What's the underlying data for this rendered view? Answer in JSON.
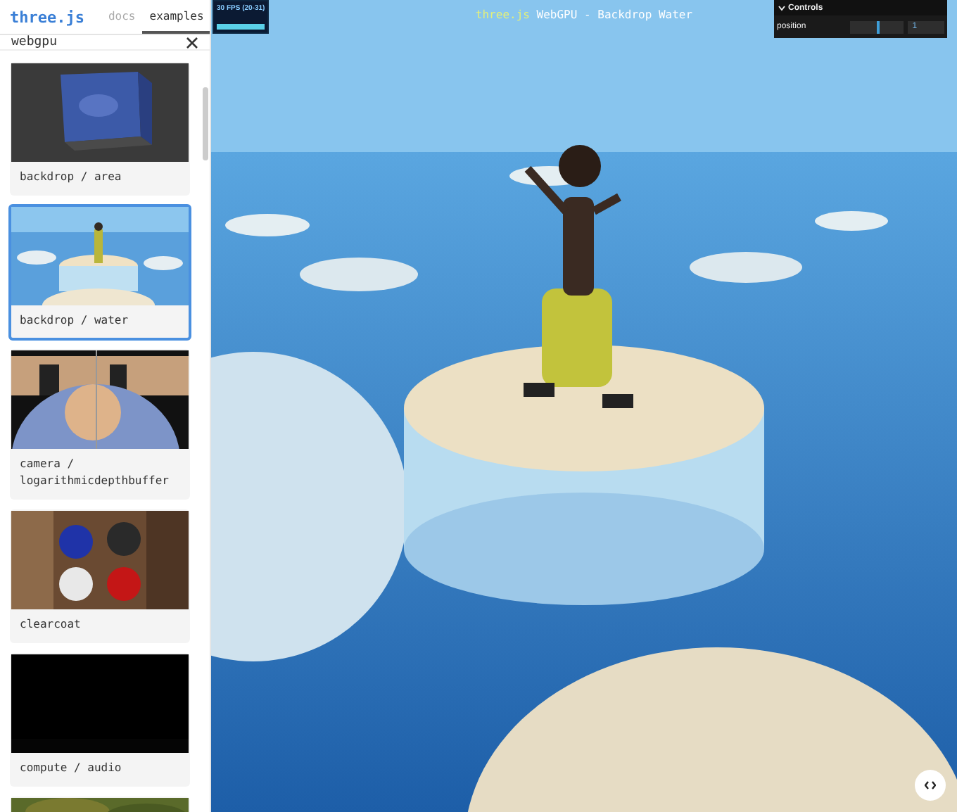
{
  "sidebar": {
    "logo": "three.js",
    "tabs": [
      {
        "label": "docs",
        "selected": false
      },
      {
        "label": "examples",
        "selected": true
      }
    ],
    "search": {
      "value": "webgpu"
    },
    "examples": [
      {
        "label": "backdrop / area",
        "selected": false
      },
      {
        "label": "backdrop / water",
        "selected": true
      },
      {
        "label": "camera / logarithmicdepthbuffer",
        "selected": false
      },
      {
        "label": "clearcoat",
        "selected": false
      },
      {
        "label": "compute / audio",
        "selected": false
      },
      {
        "selected": false
      }
    ]
  },
  "viewer": {
    "fps_meter": {
      "label": "30 FPS (20-31)"
    },
    "title": {
      "link": "three.js",
      "text": "WebGPU - Backdrop Water"
    },
    "controls": {
      "title": "Controls",
      "expanded": true,
      "rows": [
        {
          "label": "position",
          "level": 0.5,
          "value": "1"
        }
      ]
    }
  }
}
